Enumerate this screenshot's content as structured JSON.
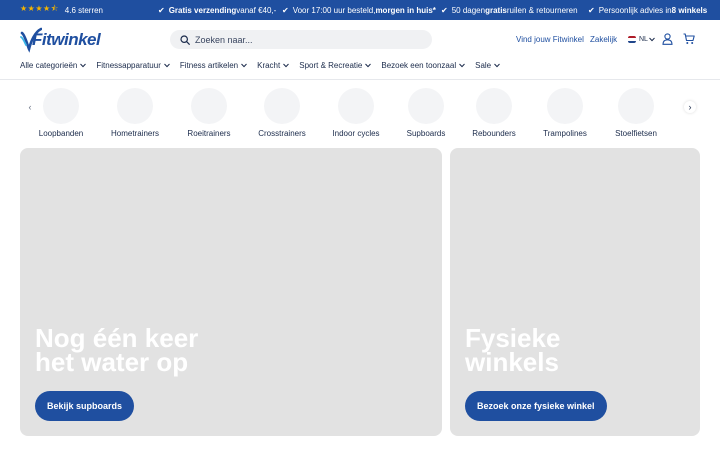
{
  "topbar": {
    "rating_stars": "★★★★⯪",
    "rating_text": "4.6 sterren",
    "usps": [
      {
        "bold_pre": "Gratis verzending",
        "text": " vanaf €40,-",
        "bold_post": ""
      },
      {
        "bold_pre": "",
        "text": "Voor 17:00 uur besteld, ",
        "bold_post": "morgen in huis*"
      },
      {
        "bold_pre": "",
        "text": "50 dagen ",
        "bold_mid": "gratis",
        "text2": " ruilen & retourneren"
      },
      {
        "bold_pre": "",
        "text": "Persoonlijk advies in ",
        "bold_post": "8 winkels"
      }
    ]
  },
  "header": {
    "logo_text": "Fitwinkel",
    "search_placeholder": "Zoeken naar...",
    "find_store": "Vind jouw Fitwinkel",
    "business": "Zakelijk",
    "language": "NL"
  },
  "nav": {
    "items": [
      "Alle categorieën",
      "Fitnessapparatuur",
      "Fitness artikelen",
      "Kracht",
      "Sport & Recreatie",
      "Bezoek een toonzaal",
      "Sale"
    ]
  },
  "categories": [
    "Loopbanden",
    "Hometrainers",
    "Roeitrainers",
    "Crosstrainers",
    "Indoor cycles",
    "Supboards",
    "Rebounders",
    "Trampolines",
    "Stoelfietsen"
  ],
  "banners": [
    {
      "title": "Nog één keer\nhet water op",
      "button": "Bekijk supboards"
    },
    {
      "title": "Fysieke\nwinkels",
      "button": "Bezoek onze fysieke winkel"
    }
  ],
  "colors": {
    "brand": "#1f4fa0",
    "star": "#f4b400",
    "banner_bg": "#e2e2e2"
  }
}
